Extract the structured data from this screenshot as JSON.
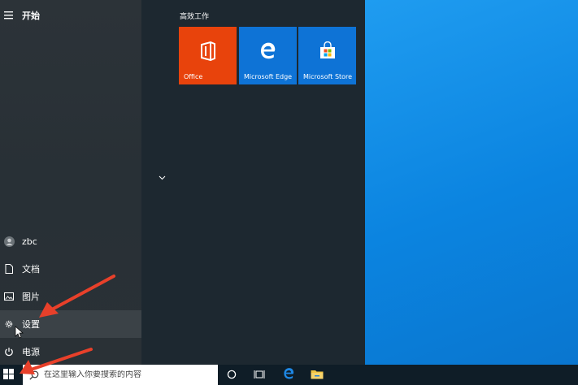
{
  "start_menu": {
    "header_label": "开始",
    "group_title": "高效工作",
    "user_name": "zbc",
    "rail_items": [
      {
        "label": "文档",
        "icon": "document-icon"
      },
      {
        "label": "图片",
        "icon": "picture-icon"
      },
      {
        "label": "设置",
        "icon": "gear-icon"
      },
      {
        "label": "电源",
        "icon": "power-icon"
      }
    ],
    "tiles": [
      {
        "label": "Office",
        "icon": "office-icon",
        "color": "#e8430c"
      },
      {
        "label": "Microsoft Edge",
        "icon": "edge-icon",
        "color": "#0e73d6"
      },
      {
        "label": "Microsoft Store",
        "icon": "store-icon",
        "color": "#0e73d6"
      }
    ]
  },
  "taskbar": {
    "search_placeholder": "在这里输入你要搜索的内容",
    "icons": [
      "windows-icon",
      "search-icon",
      "cortana-icon",
      "task-view-icon",
      "edge-icon",
      "file-explorer-icon"
    ]
  },
  "colors": {
    "desktop": "#1a8fe3",
    "annotation_arrow": "#e8402a"
  }
}
